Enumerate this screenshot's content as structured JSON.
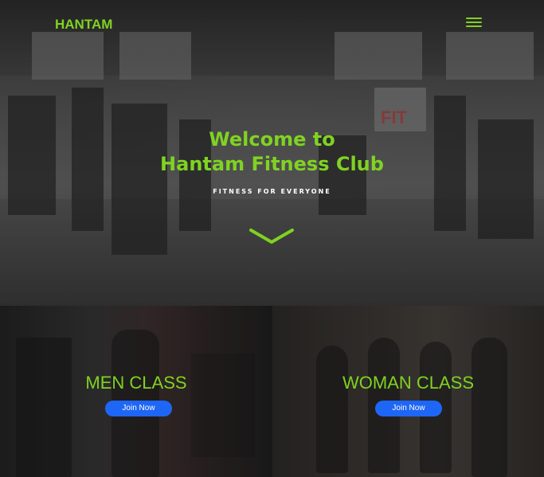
{
  "header": {
    "logo_text": "HANTAM",
    "menu_icon": "hamburger-menu-icon",
    "accent_color": "#7fd321"
  },
  "hero": {
    "title_line1": "Welcome to",
    "title_line2": "Hantam Fitness Club",
    "tagline": "FITNESS FOR EVERYONE",
    "scroll_icon": "chevron-down-icon",
    "bg_sign_text": "FIT"
  },
  "classes": [
    {
      "title": "MEN CLASS",
      "button_label": "Join Now"
    },
    {
      "title": "WOMAN CLASS",
      "button_label": "Join Now"
    }
  ],
  "button_color": "#1e66f5"
}
